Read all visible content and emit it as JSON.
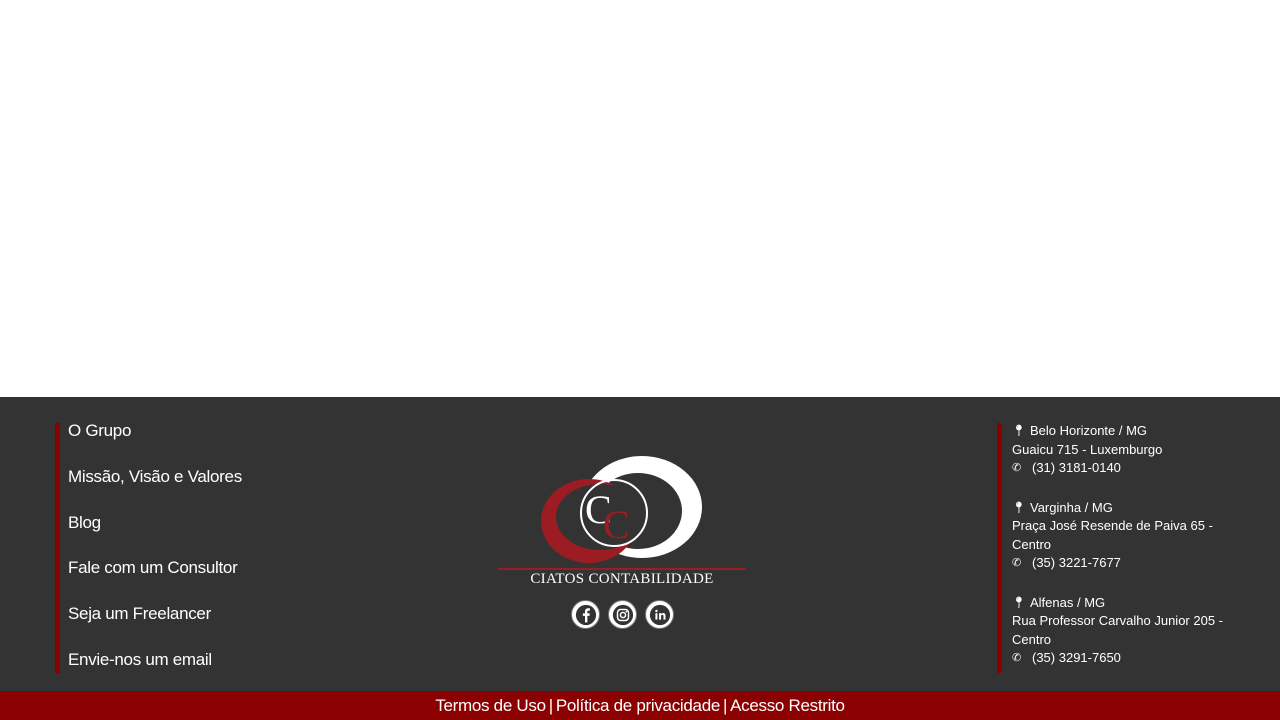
{
  "nav": {
    "items": [
      {
        "label": "O Grupo"
      },
      {
        "label": "Missão, Visão e Valores"
      },
      {
        "label": "Blog"
      },
      {
        "label": "Fale com um Consultor"
      },
      {
        "label": "Seja um Freelancer"
      },
      {
        "label": "Envie-nos um email"
      }
    ]
  },
  "logo": {
    "name": "CIATOS CONTABILIDADE",
    "colors": {
      "red": "#9b1c22",
      "white": "#ffffff"
    }
  },
  "social": {
    "icons": [
      "facebook-icon",
      "instagram-icon",
      "linkedin-icon"
    ]
  },
  "offices": [
    {
      "city": "Belo Horizonte / MG",
      "address": "Guaicu   715 - Luxemburgo",
      "phone": "(31) 3181-0140"
    },
    {
      "city": "Varginha / MG",
      "address": "Praça José Resende de Paiva  65 - Centro",
      "phone": "(35) 3221-7677"
    },
    {
      "city": "Alfenas / MG",
      "address": "Rua Professor Carvalho Junior  205 - Centro",
      "phone": "(35) 3291-7650"
    }
  ],
  "bottom": {
    "terms": "Termos de Uso",
    "privacy": "Política de privacidade",
    "restricted": "Acesso Restrito",
    "separator": "|"
  },
  "colors": {
    "footer_bg": "#333333",
    "accent": "#8b0000"
  }
}
